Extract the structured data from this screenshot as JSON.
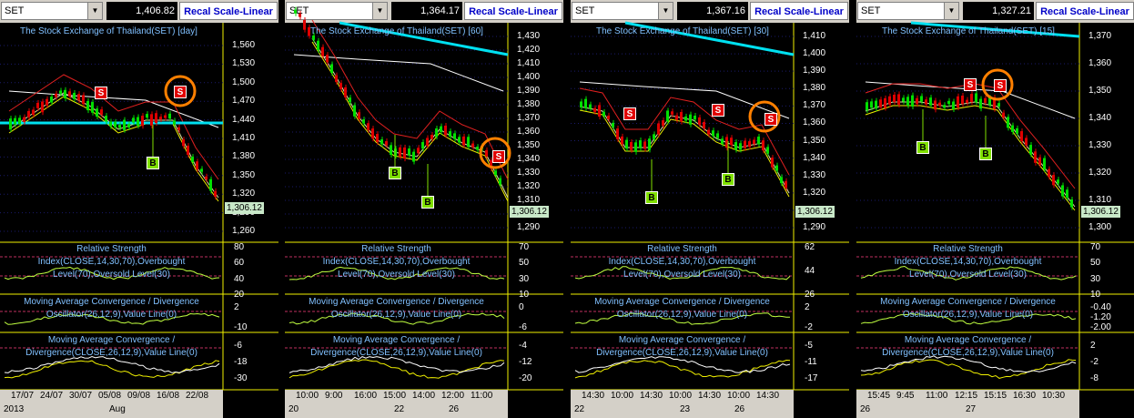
{
  "panels": [
    {
      "symbol": "SET",
      "last_price": "1,406.82",
      "recal_label": "Recal Scale-Linear",
      "title": "The Stock Exchange of Thailand(SET) [day]",
      "price_tag": "1,306.12",
      "y_labels": [
        "1,560",
        "1,530",
        "1,500",
        "1,470",
        "1,440",
        "1,410",
        "1,380",
        "1,350",
        "1,320",
        "1,290",
        "1,260"
      ],
      "rsi_title": [
        "Relative Strength",
        "Index(CLOSE,14,30,70),Overbought",
        "Level(70),Oversold Level(30)"
      ],
      "rsi_labels": [
        "80",
        "60",
        "40",
        "20"
      ],
      "macd1_title": [
        "Moving Average Convergence / Divergence",
        "Oscillator(26,12,9),Value Line(0)"
      ],
      "macd1_labels": [
        "2",
        "-10"
      ],
      "macd2_title": [
        "Moving Average Convergence /",
        "Divergence(CLOSE,26,12,9),Value Line(0)"
      ],
      "macd2_labels": [
        "-6",
        "-18",
        "-30"
      ],
      "time_labels": [
        "17/07",
        "24/07",
        "30/07",
        "05/08",
        "09/08",
        "16/08",
        "22/08"
      ],
      "bottom_labels": [
        "2013",
        "Aug"
      ]
    },
    {
      "symbol": "SET",
      "last_price": "1,364.17",
      "recal_label": "Recal Scale-Linear",
      "title": "The Stock Exchange of Thailand(SET) [60]",
      "price_tag": "1,306.12",
      "y_labels": [
        "1,430",
        "1,420",
        "1,410",
        "1,400",
        "1,390",
        "1,380",
        "1,370",
        "1,360",
        "1,350",
        "1,340",
        "1,330",
        "1,320",
        "1,310",
        "1,300",
        "1,290"
      ],
      "rsi_title": [
        "Relative Strength",
        "Index(CLOSE,14,30,70),Overbought",
        "Level(70),Oversold Level(30)"
      ],
      "rsi_labels": [
        "70",
        "50",
        "30",
        "10"
      ],
      "macd1_title": [
        "Moving Average Convergence / Divergence",
        "Oscillator(26,12,9),Value Line(0)"
      ],
      "macd1_labels": [
        "0",
        "-6"
      ],
      "macd2_title": [
        "Moving Average Convergence /",
        "Divergence(CLOSE,26,12,9),Value Line(0)"
      ],
      "macd2_labels": [
        "-4",
        "-12",
        "-20"
      ],
      "time_labels": [
        "10:00",
        "9:00",
        "16:00",
        "15:00",
        "14:00",
        "12:00",
        "11:00"
      ],
      "bottom_labels": [
        "20",
        "22",
        "26"
      ]
    },
    {
      "symbol": "SET",
      "last_price": "1,367.16",
      "recal_label": "Recal Scale-Linear",
      "title": "The Stock Exchange of Thailand(SET) [30]",
      "price_tag": "1,306.12",
      "y_labels": [
        "1,410",
        "1,400",
        "1,390",
        "1,380",
        "1,370",
        "1,360",
        "1,350",
        "1,340",
        "1,330",
        "1,320",
        "1,310",
        "1,290"
      ],
      "rsi_title": [
        "Relative Strength",
        "Index(CLOSE,14,30,70),Overbought",
        "Level(70),Oversold Level(30)"
      ],
      "rsi_labels": [
        "62",
        "44",
        "26"
      ],
      "macd1_title": [
        "Moving Average Convergence / Divergence",
        "Oscillator(26,12,9),Value Line(0)"
      ],
      "macd1_labels": [
        "2",
        "-2"
      ],
      "macd2_title": [
        "Moving Average Convergence /",
        "Divergence(CLOSE,26,12,9),Value Line(0)"
      ],
      "macd2_labels": [
        "-5",
        "-11",
        "-17"
      ],
      "time_labels": [
        "14:30",
        "10:00",
        "14:30",
        "10:00",
        "14:30",
        "10:00",
        "14:30"
      ],
      "bottom_labels": [
        "22",
        "23",
        "26"
      ]
    },
    {
      "symbol": "SET",
      "last_price": "1,327.21",
      "recal_label": "Recal Scale-Linear",
      "title": "The Stock Exchange of Thailand(SET) [15]",
      "price_tag": "1,306.12",
      "y_labels": [
        "1,370",
        "1,360",
        "1,350",
        "1,340",
        "1,330",
        "1,320",
        "1,310",
        "1,300"
      ],
      "rsi_title": [
        "Relative Strength",
        "Index(CLOSE,14,30,70),Overbought",
        "Level(70),Oversold Level(30)"
      ],
      "rsi_labels": [
        "70",
        "50",
        "30",
        "10"
      ],
      "macd1_title": [
        "Moving Average Convergence / Divergence",
        "Oscillator(26,12,9),Value Line(0)"
      ],
      "macd1_labels": [
        "-0.40",
        "-1.20",
        "-2.00"
      ],
      "macd2_title": [
        "Moving Average Convergence /",
        "Divergence(CLOSE,26,12,9),Value Line(0)"
      ],
      "macd2_labels": [
        "2",
        "-2",
        "-8"
      ],
      "time_labels": [
        "15:45",
        "9:45",
        "11:00",
        "12:15",
        "15:15",
        "16:30",
        "10:30"
      ],
      "bottom_labels": [
        "26",
        "27"
      ]
    }
  ],
  "signal_labels": {
    "sell": "S",
    "buy": "B"
  },
  "colors": {
    "sell": "#e00000",
    "buy": "#80e000",
    "highlight": "#ff8000",
    "ema": "#00e0f0",
    "ma_red": "#e02020",
    "ma_white": "#ffffff",
    "ma_yellow": "#f0f000"
  }
}
